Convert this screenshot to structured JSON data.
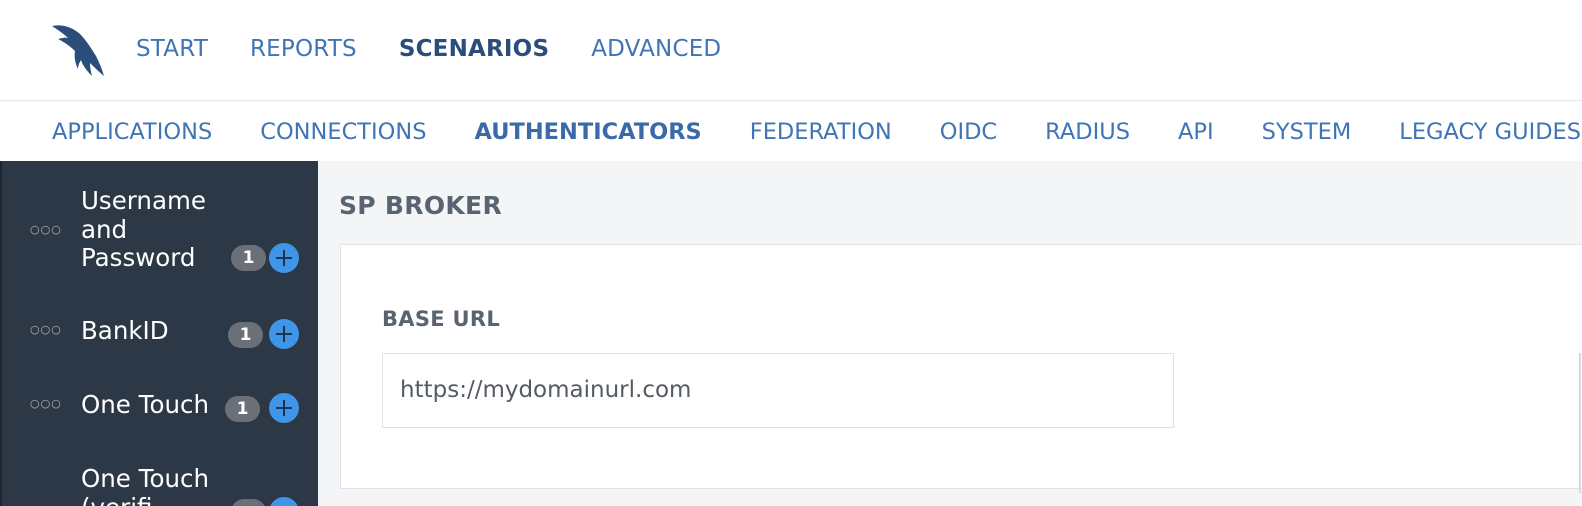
{
  "top_nav": {
    "items": [
      {
        "label": "START",
        "active": false
      },
      {
        "label": "REPORTS",
        "active": false
      },
      {
        "label": "SCENARIOS",
        "active": true
      },
      {
        "label": "ADVANCED",
        "active": false
      }
    ]
  },
  "sub_nav": {
    "items": [
      {
        "label": "APPLICATIONS",
        "active": false
      },
      {
        "label": "CONNECTIONS",
        "active": false
      },
      {
        "label": "AUTHENTICATORS",
        "active": true
      },
      {
        "label": "FEDERATION",
        "active": false
      },
      {
        "label": "OIDC",
        "active": false
      },
      {
        "label": "RADIUS",
        "active": false
      },
      {
        "label": "API",
        "active": false
      },
      {
        "label": "SYSTEM",
        "active": false
      },
      {
        "label": "LEGACY GUIDES",
        "active": false
      }
    ]
  },
  "sidebar": {
    "items": [
      {
        "label": "Username and Password",
        "count": "1",
        "icon": "add-icon"
      },
      {
        "label": "BankID",
        "count": "1",
        "icon": "add-icon"
      },
      {
        "label": "One Touch",
        "count": "1",
        "icon": "add-icon"
      },
      {
        "label": "One Touch (verifi",
        "count": "",
        "icon": "add-icon"
      }
    ]
  },
  "main": {
    "section_title": "SP BROKER",
    "base_url_label": "BASE URL",
    "base_url_value": "https://mydomainurl.com"
  },
  "colors": {
    "brand": "#2b4d7a",
    "nav_link": "#3f74b5",
    "sidebar_bg": "#2d3846",
    "add_button": "#3f96e8",
    "badge": "#6b7078"
  }
}
